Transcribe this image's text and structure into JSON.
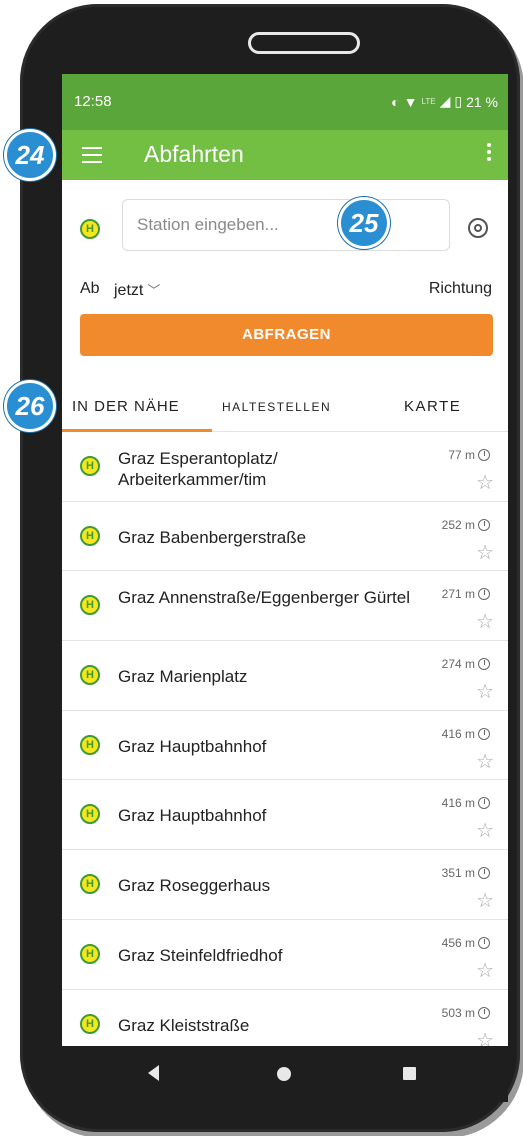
{
  "status_bar": {
    "time": "12:58",
    "battery": "21 %",
    "icons": [
      "data-saver-icon",
      "wifi-icon",
      "lte-icon",
      "signal-icon",
      "battery-icon"
    ],
    "lte_label": "LTE"
  },
  "app_bar": {
    "title": "Abfahrten",
    "menu_icon": "hamburger-menu-icon",
    "overflow_icon": "more-vert-icon"
  },
  "search": {
    "badge": "H",
    "placeholder": "Station eingeben...",
    "locate_icon": "target-icon"
  },
  "options": {
    "ab_label": "Ab",
    "time_value": "jetzt",
    "richtung_label": "Richtung"
  },
  "query_button": {
    "label": "ABFRAGEN",
    "color": "#f08a2c"
  },
  "tabs": [
    {
      "label": "IN DER NÄHE",
      "active": true
    },
    {
      "label": "HALTESTELLEN",
      "active": false
    },
    {
      "label": "KARTE",
      "active": false
    }
  ],
  "stops": [
    {
      "name": "Graz Esperantoplatz/ Arbeiterkammer/tim",
      "distance": "77 m"
    },
    {
      "name": "Graz Babenbergerstraße",
      "distance": "252 m"
    },
    {
      "name": "Graz Annenstraße/Eggenberger Gürtel",
      "distance": "271 m"
    },
    {
      "name": "Graz Marienplatz",
      "distance": "274 m"
    },
    {
      "name": "Graz Hauptbahnhof",
      "distance": "416 m"
    },
    {
      "name": "Graz Hauptbahnhof",
      "distance": "416 m"
    },
    {
      "name": "Graz Roseggerhaus",
      "distance": "351 m"
    },
    {
      "name": "Graz Steinfeldfriedhof",
      "distance": "456 m"
    },
    {
      "name": "Graz Kleiststraße",
      "distance": "503 m"
    }
  ],
  "callouts": {
    "c24": "24",
    "c25": "25",
    "c26": "26"
  },
  "colors": {
    "status_bar": "#5aa63a",
    "app_bar": "#72bf44",
    "accent": "#f08a2c",
    "callout": "#2a8fd2",
    "badge_yellow": "#f5e71b",
    "badge_green": "#3e9a38"
  }
}
